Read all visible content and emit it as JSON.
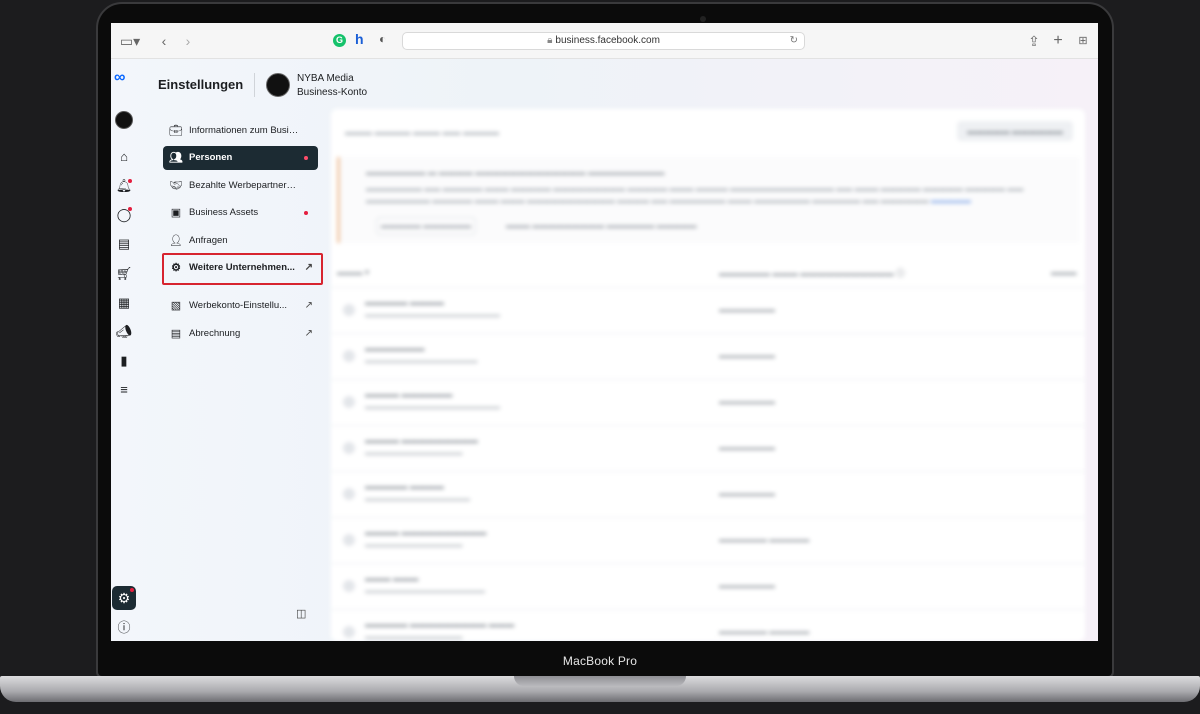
{
  "device": {
    "label": "MacBook Pro"
  },
  "browser": {
    "url": "business.facebook.com",
    "toolbar_icons": [
      "sidebar-icon",
      "back-icon",
      "forward-icon",
      "share-icon",
      "new-tab-icon",
      "tab-overview-icon"
    ],
    "extensions": [
      "grammarly-icon",
      "honey-icon",
      "privacy-shield-icon"
    ]
  },
  "header": {
    "title": "Einstellungen",
    "business_name": "NYBA Media",
    "business_type": "Business-Konto"
  },
  "settings_menu": {
    "items": [
      {
        "label": "Informationen zum Busin...",
        "icon": "briefcase-icon",
        "dot": false,
        "external": false,
        "active": false
      },
      {
        "label": "Personen",
        "icon": "people-icon",
        "dot": true,
        "external": false,
        "active": true
      },
      {
        "label": "Bezahlte Werbepartners...",
        "icon": "handshake-icon",
        "dot": false,
        "external": false,
        "active": false
      },
      {
        "label": "Business Assets",
        "icon": "box-icon",
        "dot": true,
        "external": false,
        "active": false
      },
      {
        "label": "Anfragen",
        "icon": "person-check-icon",
        "dot": false,
        "external": false,
        "active": false
      },
      {
        "label": "Weitere Unternehmen...",
        "icon": "gear-icon",
        "dot": false,
        "external": true,
        "active": false,
        "highlighted": true
      },
      {
        "label": "Werbekonto-Einstellu...",
        "icon": "ad-accounts-icon",
        "dot": false,
        "external": true,
        "active": false
      },
      {
        "label": "Abrechnung",
        "icon": "billing-icon",
        "dot": false,
        "external": true,
        "active": false
      }
    ]
  },
  "colors": {
    "active_bg": "#1c2b33",
    "notification_dot": "#e41e3f",
    "highlight_box": "#d7242f",
    "meta_blue": "#0866ff"
  }
}
